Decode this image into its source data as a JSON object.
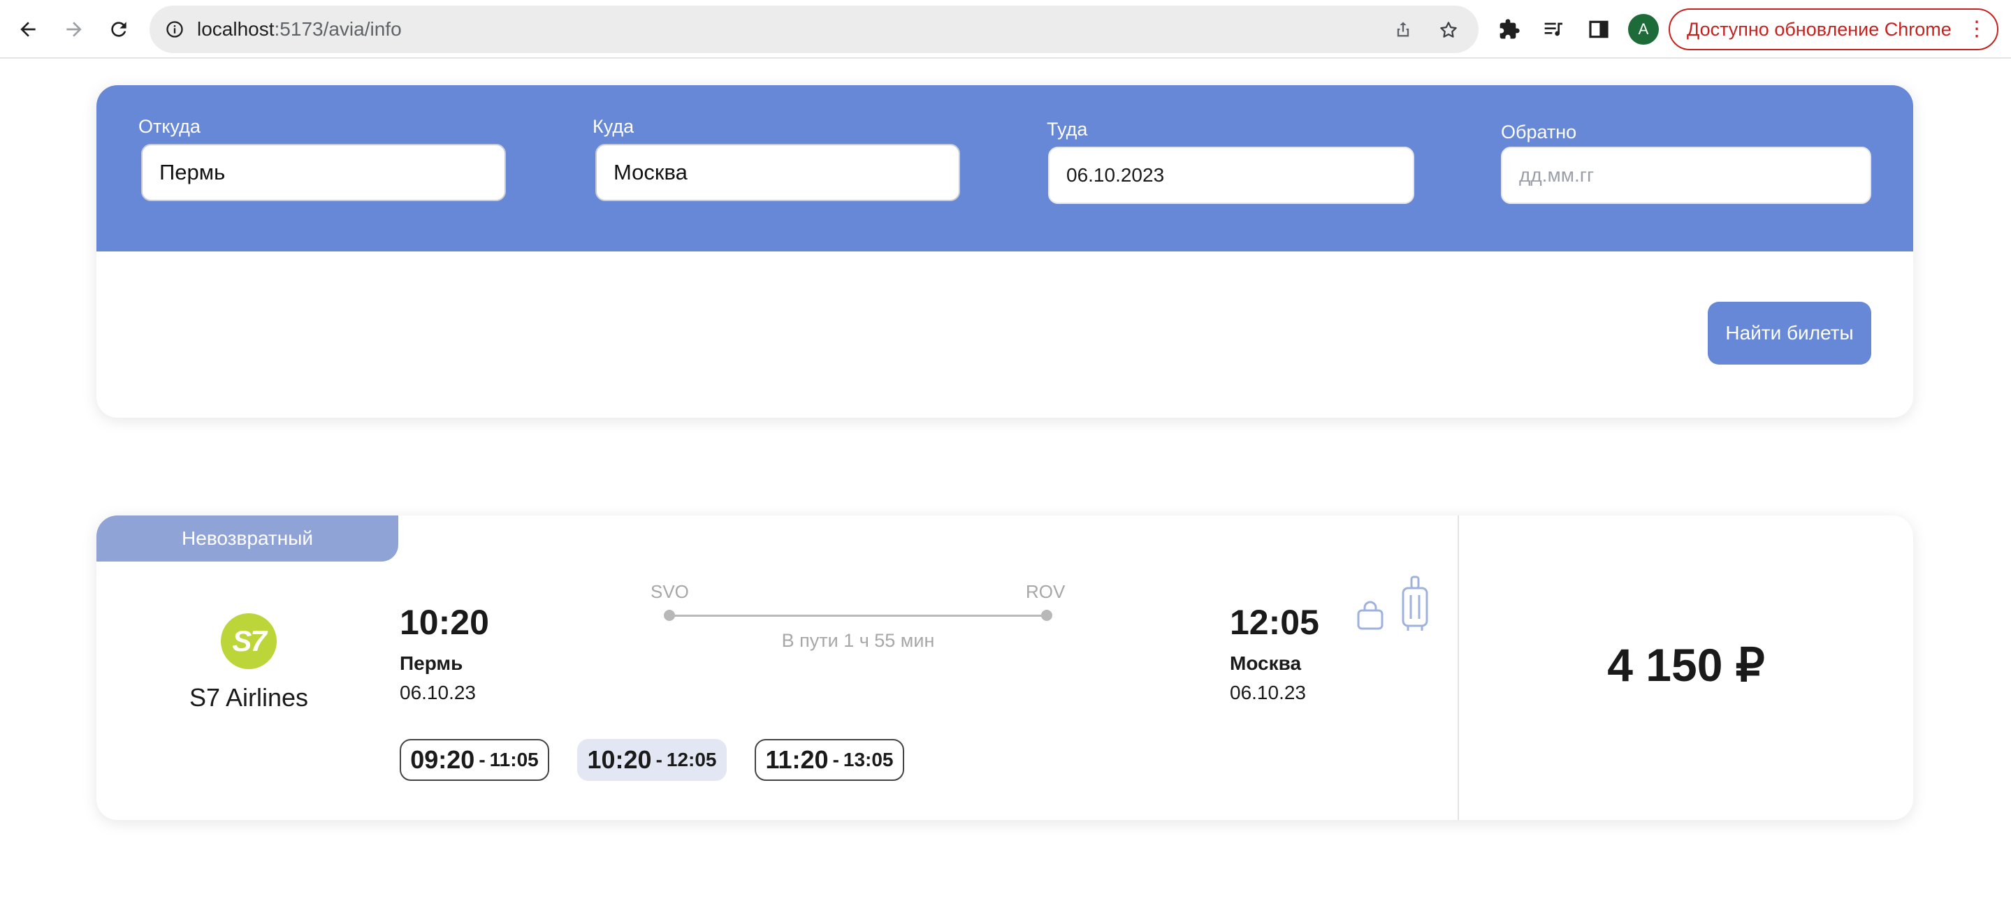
{
  "browser": {
    "url_host": "localhost",
    "url_path": ":5173/avia/info",
    "profile_initial": "A",
    "update_label": "Доступно обновление Chrome",
    "menu_glyph": "⋮"
  },
  "search": {
    "from_label": "Откуда",
    "from_value": "Пермь",
    "to_label": "Куда",
    "to_value": "Москва",
    "depart_label": "Туда",
    "depart_value": "06.10.2023",
    "return_label": "Обратно",
    "return_placeholder": "дд.мм.гг",
    "submit_label": "Найти билеты"
  },
  "ticket": {
    "fare_type": "Невозвратный",
    "airline_logo_text": "S7",
    "airline_name": "S7 Airlines",
    "departure": {
      "time": "10:20",
      "city": "Пермь",
      "date": "06.10.23",
      "iata": "SVO"
    },
    "arrival": {
      "time": "12:05",
      "city": "Москва",
      "date": "06.10.23",
      "iata": "ROV"
    },
    "duration": "В пути 1 ч 55 мин",
    "slots": [
      {
        "dep": "09:20",
        "sep": "-",
        "arr": "11:05"
      },
      {
        "dep": "10:20",
        "sep": "-",
        "arr": "12:05"
      },
      {
        "dep": "11:20",
        "sep": "-",
        "arr": "13:05"
      }
    ],
    "price": "4 150 ₽"
  },
  "colors": {
    "accent": "#6788d6",
    "fare_tab": "#8fa3d6",
    "logo": "#bcd539",
    "update": "#c5221f"
  },
  "icons": [
    "back-arrow-icon",
    "forward-arrow-icon",
    "reload-icon",
    "info-icon",
    "share-icon",
    "star-icon",
    "extensions-icon",
    "media-icon",
    "side-panel-icon",
    "bag-icon",
    "suitcase-icon"
  ]
}
